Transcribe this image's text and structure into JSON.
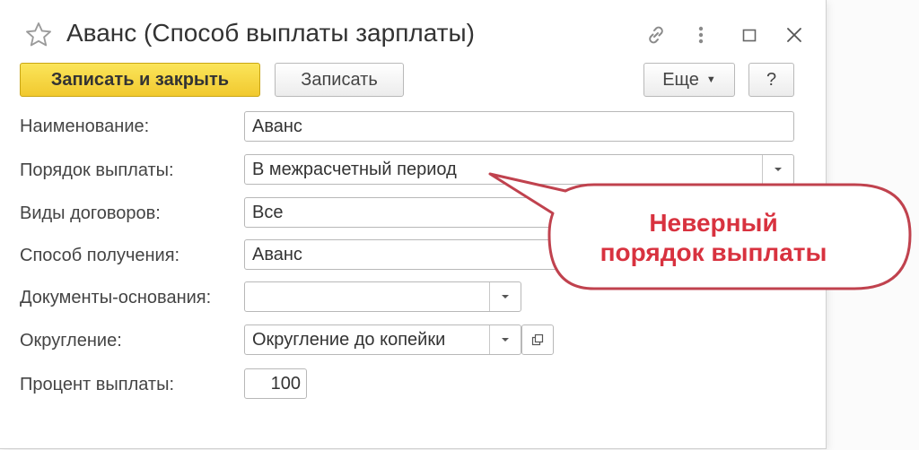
{
  "window": {
    "title": "Аванс (Способ выплаты зарплаты)"
  },
  "titlebar_icons": [
    "star-icon",
    "link-icon",
    "more-vertical-icon",
    "maximize-icon",
    "close-icon"
  ],
  "toolbar": {
    "save_close_label": "Записать и закрыть",
    "save_label": "Записать",
    "more_label": "Еще",
    "help_label": "?"
  },
  "form": {
    "name": {
      "label": "Наименование:",
      "value": "Аванс"
    },
    "payment_order": {
      "label": "Порядок выплаты:",
      "value": "В межрасчетный период"
    },
    "contract_types": {
      "label": "Виды договоров:",
      "value": "Все"
    },
    "receipt_method": {
      "label": "Способ получения:",
      "value": "Аванс"
    },
    "base_documents": {
      "label": "Документы-основания:",
      "value": ""
    },
    "rounding": {
      "label": "Округление:",
      "value": "Округление до копейки"
    },
    "payment_percent": {
      "label": "Процент выплаты:",
      "value": "100"
    }
  },
  "callout": {
    "line1": "Неверный",
    "line2": "порядок выплаты",
    "color": "#d8323f"
  },
  "colors": {
    "primary_button": "#f5d43a",
    "callout_border": "#c0424e"
  }
}
